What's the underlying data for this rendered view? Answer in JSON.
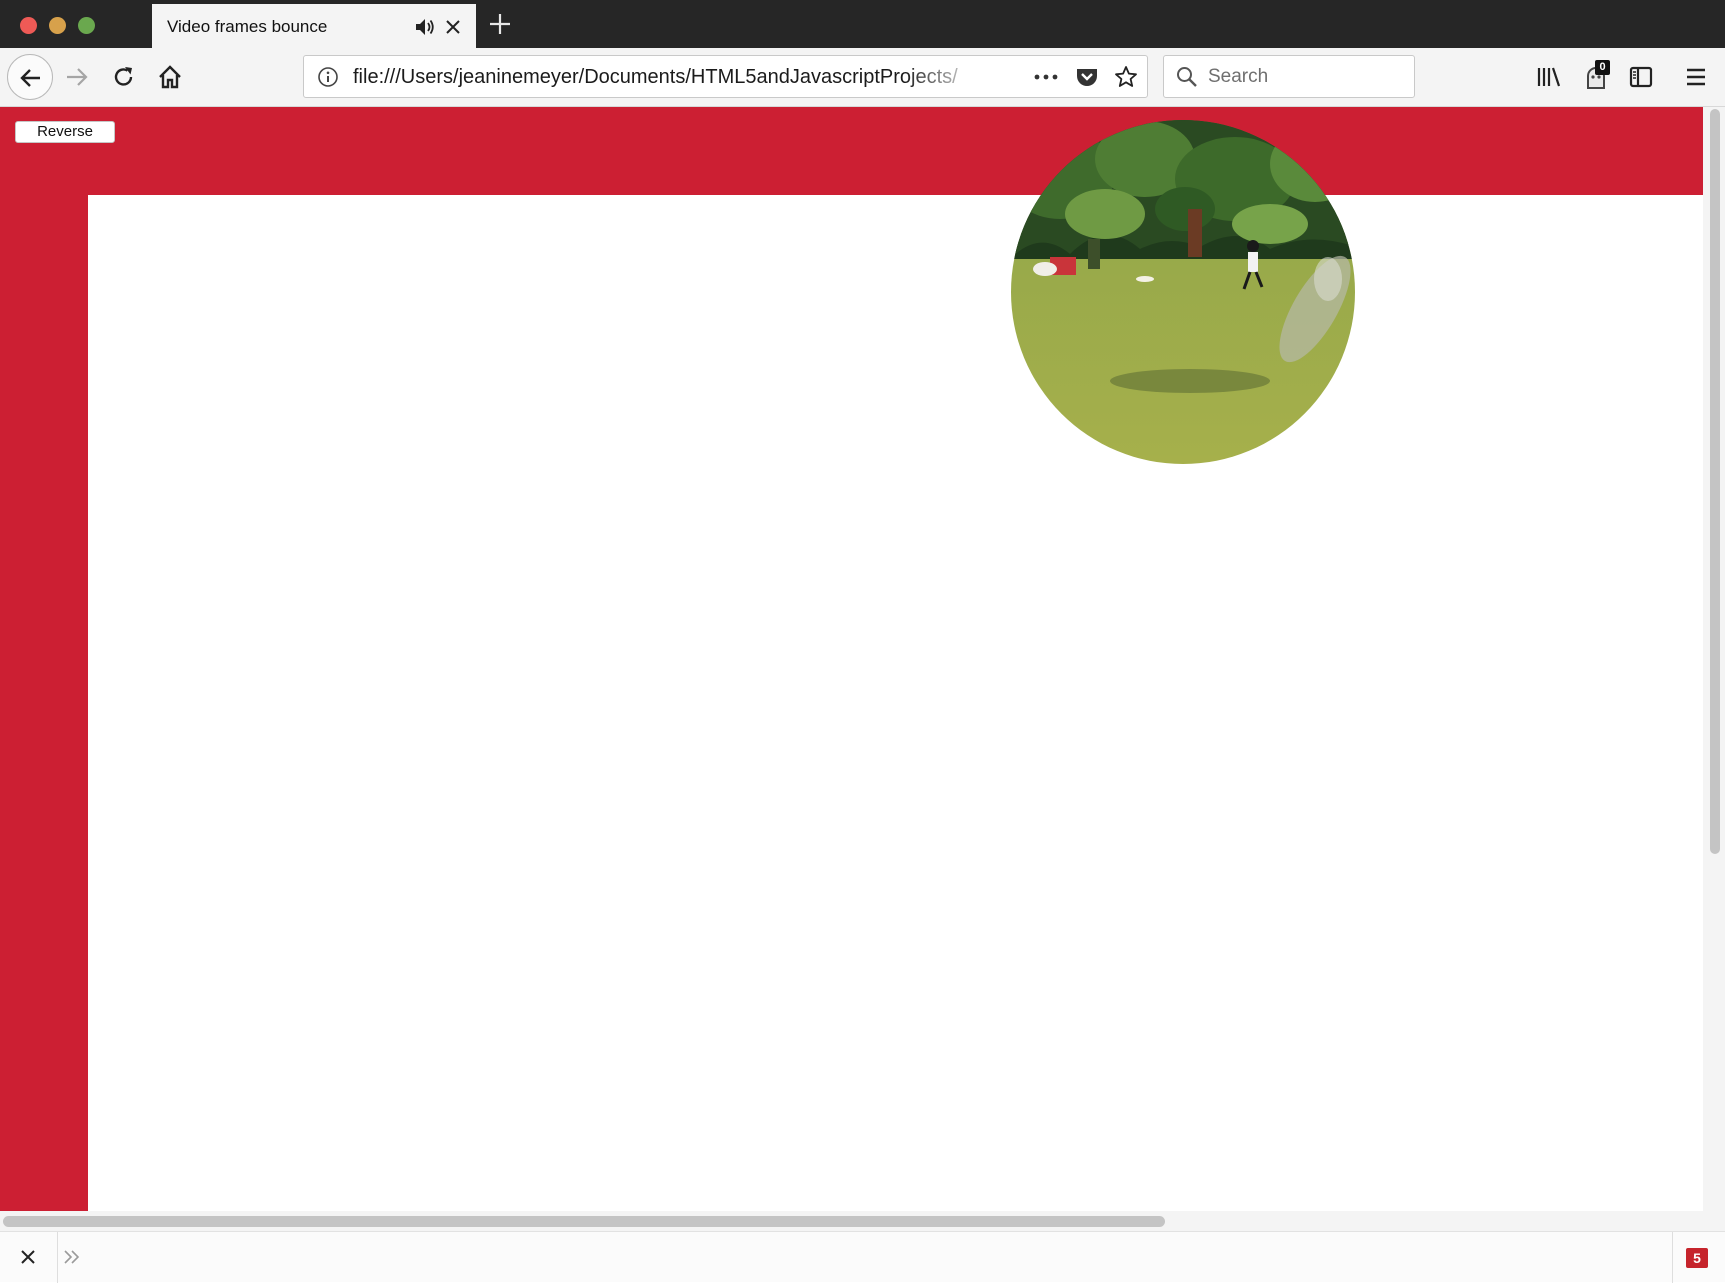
{
  "browser": {
    "tab": {
      "title": "Video frames bounce",
      "audio_icon": "speaker-icon",
      "close_icon": "close-icon"
    },
    "new_tab_icon": "plus-icon",
    "traffic_lights": {
      "close_color": "#ee5a56",
      "minimize_color": "#d7a14b",
      "maximize_color": "#6aa84e"
    },
    "nav": {
      "back_icon": "back-arrow-icon",
      "forward_icon": "forward-arrow-icon",
      "reload_icon": "reload-icon",
      "home_icon": "home-icon"
    },
    "url_bar": {
      "info_icon": "info-icon",
      "url": "file:///Users/jeaninemeyer/Documents/HTML5andJavascriptProjects/",
      "more_icon": "more-dots-icon",
      "pocket_icon": "pocket-icon",
      "bookmark_icon": "star-icon"
    },
    "search_bar": {
      "placeholder": "Search",
      "icon": "search-icon"
    },
    "toolbar": {
      "library_icon": "library-icon",
      "extension_icon": "extension-icon",
      "extension_badge": "0",
      "sidebar_icon": "sidebar-icon",
      "menu_icon": "hamburger-menu-icon"
    }
  },
  "page": {
    "background_color": "#cc1f33",
    "reverse_button_label": "Reverse",
    "video_ball": "video-frame-ball"
  },
  "bottom_bar": {
    "close_icon": "close-icon",
    "overflow_icon": "double-chevron-icon",
    "badge_count": "5",
    "badge_color": "#c6242c"
  }
}
